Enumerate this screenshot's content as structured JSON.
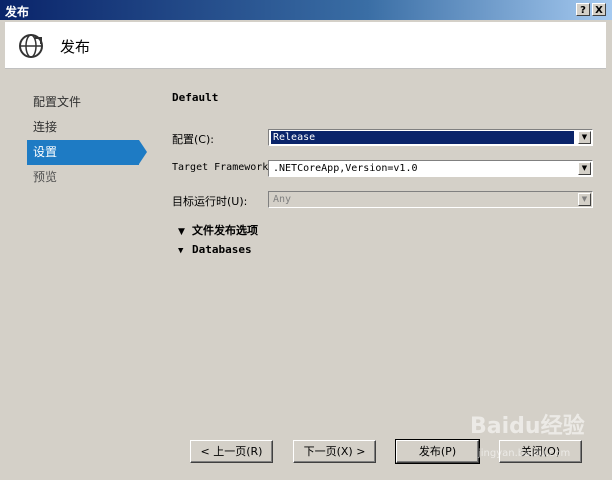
{
  "window": {
    "title": "发布",
    "help_label": "?",
    "close_label": "X"
  },
  "header": {
    "title": "发布",
    "icon": "publish-globe-icon"
  },
  "nav": {
    "items": [
      {
        "label": "配置文件",
        "state": "normal"
      },
      {
        "label": "连接",
        "state": "normal"
      },
      {
        "label": "设置",
        "state": "active"
      },
      {
        "label": "预览",
        "state": "muted"
      }
    ]
  },
  "main": {
    "profile_name": "Default",
    "configuration": {
      "label": "配置(C):",
      "value": "Release"
    },
    "target_framework": {
      "label": "Target Framework:",
      "value": ".NETCoreApp,Version=v1.0"
    },
    "target_runtime": {
      "label": "目标运行时(U):",
      "value": "Any"
    },
    "sections": [
      {
        "label": "文件发布选项",
        "icon": "chevron-down-icon"
      },
      {
        "label": "Databases",
        "icon": "chevron-down-icon"
      }
    ]
  },
  "buttons": {
    "prev": "< 上一页(R)",
    "next": "下一页(X) >",
    "publish": "发布(P)",
    "close": "关闭(O)"
  },
  "colors": {
    "accent": "#1e7bc4",
    "title_bar": "#0a246a",
    "selection": "#0a246a"
  },
  "watermark": {
    "text": "Baidu经验",
    "sub": "jingyan.baidu.com"
  }
}
